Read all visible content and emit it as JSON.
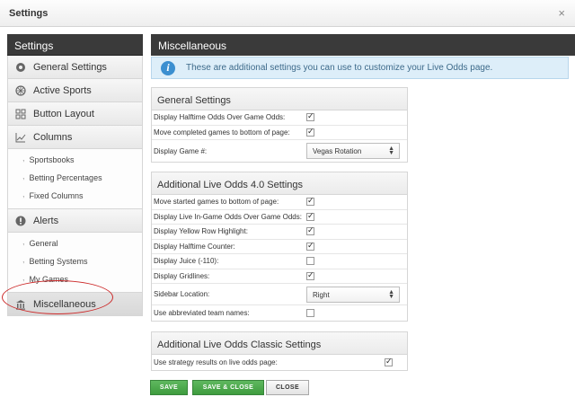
{
  "window": {
    "title": "Settings",
    "close_glyph": "×"
  },
  "sidebar": {
    "header": "Settings",
    "items": [
      {
        "label": "General Settings",
        "icon": "gear-icon"
      },
      {
        "label": "Active Sports",
        "icon": "ball-icon"
      },
      {
        "label": "Button Layout",
        "icon": "grid-icon"
      },
      {
        "label": "Columns",
        "icon": "chart-icon"
      },
      {
        "label": "Alerts",
        "icon": "alert-icon"
      },
      {
        "label": "Miscellaneous",
        "icon": "building-icon"
      }
    ],
    "columns_sub": [
      "Sportsbooks",
      "Betting Percentages",
      "Fixed Columns"
    ],
    "alerts_sub": [
      "General",
      "Betting Systems",
      "My Games"
    ]
  },
  "main": {
    "header": "Miscellaneous",
    "info": "These are additional settings you can use to customize your Live Odds page."
  },
  "general": {
    "title": "General Settings",
    "rows": [
      {
        "label": "Display Halftime Odds Over Game Odds:",
        "checked": true
      },
      {
        "label": "Move completed games to bottom of page:",
        "checked": true
      }
    ],
    "display_game_label": "Display Game #:",
    "display_game_value": "Vegas Rotation"
  },
  "lo4": {
    "title": "Additional Live Odds 4.0 Settings",
    "rows": [
      {
        "label": "Move started games to bottom of page:",
        "checked": true
      },
      {
        "label": "Display Live In-Game Odds Over Game Odds:",
        "checked": true
      },
      {
        "label": "Display Yellow Row Highlight:",
        "checked": true
      },
      {
        "label": "Display Halftime Counter:",
        "checked": true
      },
      {
        "label": "Display Juice (-110):",
        "checked": false
      },
      {
        "label": "Display Gridlines:",
        "checked": true
      }
    ],
    "sidebar_location_label": "Sidebar Location:",
    "sidebar_location_value": "Right",
    "abbrev_label": "Use abbreviated team names:",
    "abbrev_checked": false
  },
  "classic": {
    "title": "Additional Live Odds Classic Settings",
    "row_label": "Use strategy results on live odds page:",
    "row_checked": true
  },
  "buttons": {
    "save": "SAVE",
    "save_close": "SAVE & CLOSE",
    "close": "CLOSE"
  }
}
